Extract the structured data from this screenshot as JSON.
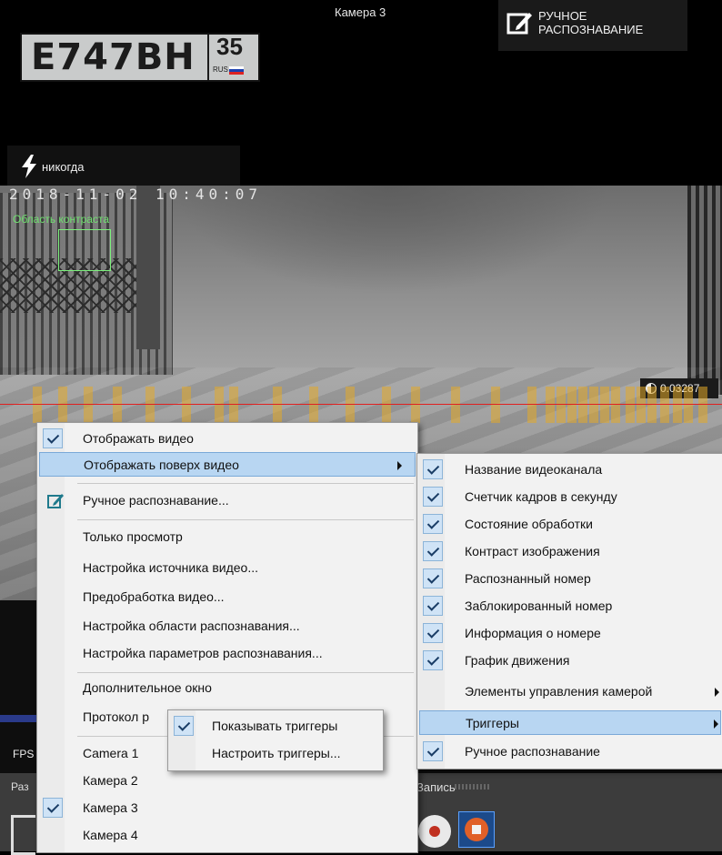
{
  "camera_title": "Камера 3",
  "manual_badge": {
    "line1": "РУЧНОЕ",
    "line2": "РАСПОЗНАВАНИЕ",
    "icon": "edit-icon"
  },
  "plate": {
    "number": "E747BH",
    "region": "35",
    "country": "RUS"
  },
  "trigger_status": {
    "icon": "lightning-icon",
    "text": "никогда"
  },
  "video": {
    "timestamp": "2018-11-02 10:40:07",
    "contrast_area_label": "Область контраста",
    "contrast_value": "0.03287"
  },
  "fps_label": "FPS",
  "bottom_bar": {
    "left_label": "Раз",
    "record_label": "Запись"
  },
  "main_menu": {
    "items": [
      {
        "label": "Отображать видео",
        "checked": true
      },
      {
        "label": "Отображать поверх видео",
        "submenu": true,
        "highlighted": true
      },
      {
        "label": "Ручное распознавание...",
        "icon": "pencil-icon"
      },
      {
        "label": "Только просмотр"
      },
      {
        "label": "Настройка источника видео..."
      },
      {
        "label": "Предобработка видео..."
      },
      {
        "label": "Настройка области распознавания..."
      },
      {
        "label": "Настройка параметров распознавания..."
      },
      {
        "label": "Дополнительное окно"
      },
      {
        "label": "Протокол р"
      },
      {
        "label": "Camera 1"
      },
      {
        "label": "Камера 2"
      },
      {
        "label": "Камера 3",
        "checked": true
      },
      {
        "label": "Камера 4"
      }
    ]
  },
  "overlay_submenu": {
    "items": [
      {
        "label": "Название видеоканала",
        "checked": true
      },
      {
        "label": "Счетчик кадров в секунду",
        "checked": true
      },
      {
        "label": "Состояние обработки",
        "checked": true
      },
      {
        "label": "Контраст изображения",
        "checked": true
      },
      {
        "label": "Распознанный номер",
        "checked": true
      },
      {
        "label": "Заблокированный номер",
        "checked": true
      },
      {
        "label": "Информация о номере",
        "checked": true
      },
      {
        "label": "График движения",
        "checked": true
      },
      {
        "label": "Элементы управления камерой",
        "submenu": true
      },
      {
        "label": "Триггеры",
        "submenu": true,
        "highlighted": true
      },
      {
        "label": "Ручное распознавание",
        "checked": true
      }
    ]
  },
  "triggers_submenu": {
    "items": [
      {
        "label": "Показывать триггеры",
        "checked": true
      },
      {
        "label": "Настроить триггеры..."
      }
    ]
  },
  "colors": {
    "menu_highlight": "#b8d6f2",
    "contrast_box": "#7cf07c",
    "motion_line": "#e02020",
    "motion_bars": "#e4aa28"
  }
}
